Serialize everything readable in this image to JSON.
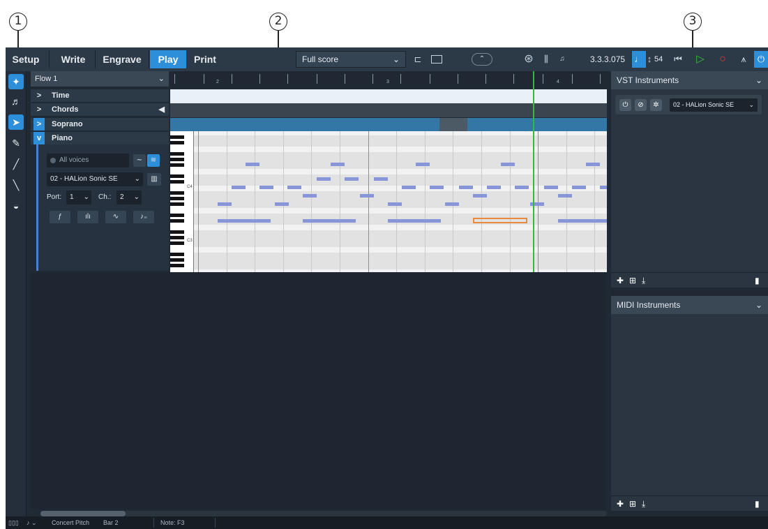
{
  "callouts": [
    "1",
    "2",
    "3"
  ],
  "colors": {
    "accent": "#2d8fd9",
    "background": "#202a35",
    "toolbar": "#2c3947",
    "note": "#8796d8",
    "selected_note": "#e98a3c",
    "playhead": "#2fbe34",
    "soprano_lane": "#3277a6"
  },
  "toolbar": {
    "modes": [
      "Setup",
      "Write",
      "Engrave",
      "Play",
      "Print"
    ],
    "active_mode": "Play",
    "layout_select": "Full score",
    "position": "3.3.3.075",
    "tempo": "54",
    "icons": [
      "galley-view-icon",
      "page-view-icon",
      "collapse-icon",
      "video-icon",
      "mixer-icon",
      "midi-icon",
      "note-tempo-icon",
      "rewind-icon",
      "play-icon",
      "record-icon",
      "metronome-icon",
      "power-icon"
    ]
  },
  "toolbox": {
    "tools": [
      "play-mode-icon",
      "music-note-icon",
      "select-tool-icon",
      "draw-tool-icon",
      "line-tool-icon",
      "velocity-tool-icon",
      "erase-tool-icon"
    ]
  },
  "event_display": {
    "flow": "Flow 1",
    "tracks": [
      {
        "label": "Time",
        "arrow": ">"
      },
      {
        "label": "Chords",
        "arrow": ">"
      },
      {
        "label": "Soprano",
        "arrow": ">"
      },
      {
        "label": "Piano",
        "arrow": "v"
      }
    ],
    "piano": {
      "voices_placeholder": "All voices",
      "instrument": "02 - HALion Sonic SE",
      "port_label": "Port:",
      "port_value": "1",
      "channel_label": "Ch.:",
      "channel_value": "2"
    },
    "ruler_bars": [
      "2",
      "3",
      "4"
    ],
    "octave_labels": [
      "C4",
      "C3"
    ]
  },
  "right_panel": {
    "vst_title": "VST Instruments",
    "vst_instrument": "02 - HALion Sonic SE",
    "midi_title": "MIDI Instruments"
  },
  "status_bar": {
    "concert_pitch": "Concert Pitch",
    "bar": "Bar 2",
    "note": "Note: F3"
  }
}
